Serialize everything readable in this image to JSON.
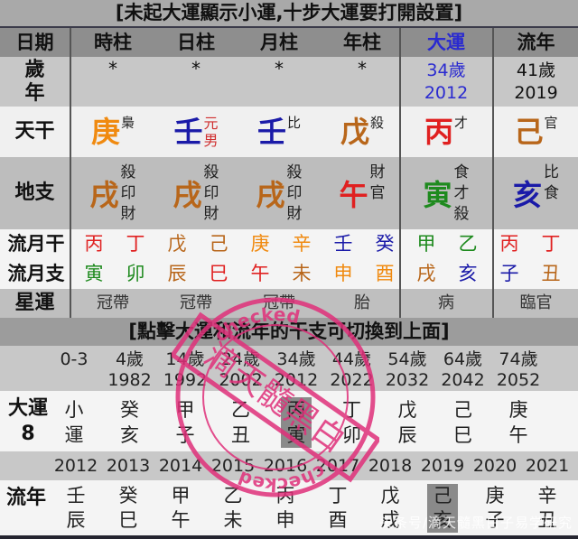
{
  "banner_top": "[未起大運顯示小運,十步大運要打開設置]",
  "header": {
    "label": "日期",
    "columns": [
      "時柱",
      "日柱",
      "月柱",
      "年柱",
      "大運",
      "流年"
    ]
  },
  "age_row": {
    "label_top": "歲",
    "label_bottom": "年",
    "values": [
      "*",
      "*",
      "*",
      "*"
    ],
    "dayun_age": "34歲",
    "dayun_year": "2012",
    "liunian_age": "41歲",
    "liunian_year": "2019"
  },
  "stem_row": {
    "label": "天干",
    "cells": [
      {
        "char": "庚",
        "element": "metal",
        "note": "梟"
      },
      {
        "char": "壬",
        "element": "water",
        "note": "元男"
      },
      {
        "char": "壬",
        "element": "water",
        "note": "比"
      },
      {
        "char": "戊",
        "element": "earth",
        "note": "殺"
      },
      {
        "char": "丙",
        "element": "fire",
        "note": "才"
      },
      {
        "char": "己",
        "element": "earth",
        "note": "官"
      }
    ]
  },
  "branch_row": {
    "label": "地支",
    "cells": [
      {
        "char": "戌",
        "element": "earth",
        "notes": [
          "殺",
          "印",
          "財"
        ]
      },
      {
        "char": "戌",
        "element": "earth",
        "notes": [
          "殺",
          "印",
          "財"
        ]
      },
      {
        "char": "戌",
        "element": "earth",
        "notes": [
          "殺",
          "印",
          "財"
        ]
      },
      {
        "char": "午",
        "element": "fire",
        "notes": [
          "財",
          "官"
        ]
      },
      {
        "char": "寅",
        "element": "wood",
        "notes": [
          "食",
          "才",
          "殺"
        ]
      },
      {
        "char": "亥",
        "element": "water",
        "notes": [
          "比",
          "食"
        ]
      }
    ]
  },
  "monthly_stems": {
    "label": "流月干",
    "items": [
      {
        "char": "丙",
        "element": "fire"
      },
      {
        "char": "丁",
        "element": "fire"
      },
      {
        "char": "戊",
        "element": "earth"
      },
      {
        "char": "己",
        "element": "earth"
      },
      {
        "char": "庚",
        "element": "metal"
      },
      {
        "char": "辛",
        "element": "metal"
      },
      {
        "char": "壬",
        "element": "water"
      },
      {
        "char": "癸",
        "element": "water"
      },
      {
        "char": "甲",
        "element": "wood"
      },
      {
        "char": "乙",
        "element": "wood"
      },
      {
        "char": "丙",
        "element": "fire"
      },
      {
        "char": "丁",
        "element": "fire"
      }
    ]
  },
  "monthly_branches": {
    "label": "流月支",
    "items": [
      {
        "char": "寅",
        "element": "wood"
      },
      {
        "char": "卯",
        "element": "wood"
      },
      {
        "char": "辰",
        "element": "earth"
      },
      {
        "char": "巳",
        "element": "fire"
      },
      {
        "char": "午",
        "element": "fire"
      },
      {
        "char": "未",
        "element": "earth"
      },
      {
        "char": "申",
        "element": "metal"
      },
      {
        "char": "酉",
        "element": "metal"
      },
      {
        "char": "戌",
        "element": "earth"
      },
      {
        "char": "亥",
        "element": "water"
      },
      {
        "char": "子",
        "element": "water"
      },
      {
        "char": "丑",
        "element": "earth"
      }
    ]
  },
  "star_row": {
    "label": "星運",
    "values": [
      "冠帶",
      "冠帶",
      "冠帶",
      "胎",
      "病",
      "臨官"
    ]
  },
  "banner_mid": "[點擊大運和流年的干支可切換到上面]",
  "dayun": {
    "label": "大運",
    "start": "8",
    "ages": [
      "0-3",
      "4歲",
      "14歲",
      "24歲",
      "34歲",
      "44歲",
      "54歲",
      "64歲",
      "74歲"
    ],
    "years": [
      "",
      "1982",
      "1992",
      "2002",
      "2012",
      "2022",
      "2032",
      "2042",
      "2052"
    ],
    "stems": [
      "小",
      "癸",
      "甲",
      "乙",
      "丙",
      "丁",
      "戊",
      "己",
      "庚"
    ],
    "branches": [
      "運",
      "亥",
      "子",
      "丑",
      "寅",
      "卯",
      "辰",
      "巳",
      "午"
    ],
    "selected_index": 4
  },
  "liunian": {
    "label": "流年",
    "years": [
      "2012",
      "2013",
      "2014",
      "2015",
      "2016",
      "2017",
      "2018",
      "2019",
      "2020",
      "2021"
    ],
    "stems": [
      "壬",
      "癸",
      "甲",
      "乙",
      "丙",
      "丁",
      "戊",
      "己",
      "庚",
      "辛"
    ],
    "branches": [
      "辰",
      "巳",
      "午",
      "未",
      "申",
      "酉",
      "戌",
      "亥",
      "子",
      "丑"
    ],
    "selected_index": 7
  },
  "stamp": {
    "text": "滴天髓黑白",
    "ring_text": "checked"
  },
  "watermark": "头条号/滴天髓黑白子易学研究",
  "colors": {
    "fire": "#e02020",
    "earth": "#b8661a",
    "metal": "#f08a10",
    "water": "#1a1aa8",
    "wood": "#1e8a1e",
    "dayun_accent": "#2a2ad0",
    "stamp": "#e0307a"
  }
}
